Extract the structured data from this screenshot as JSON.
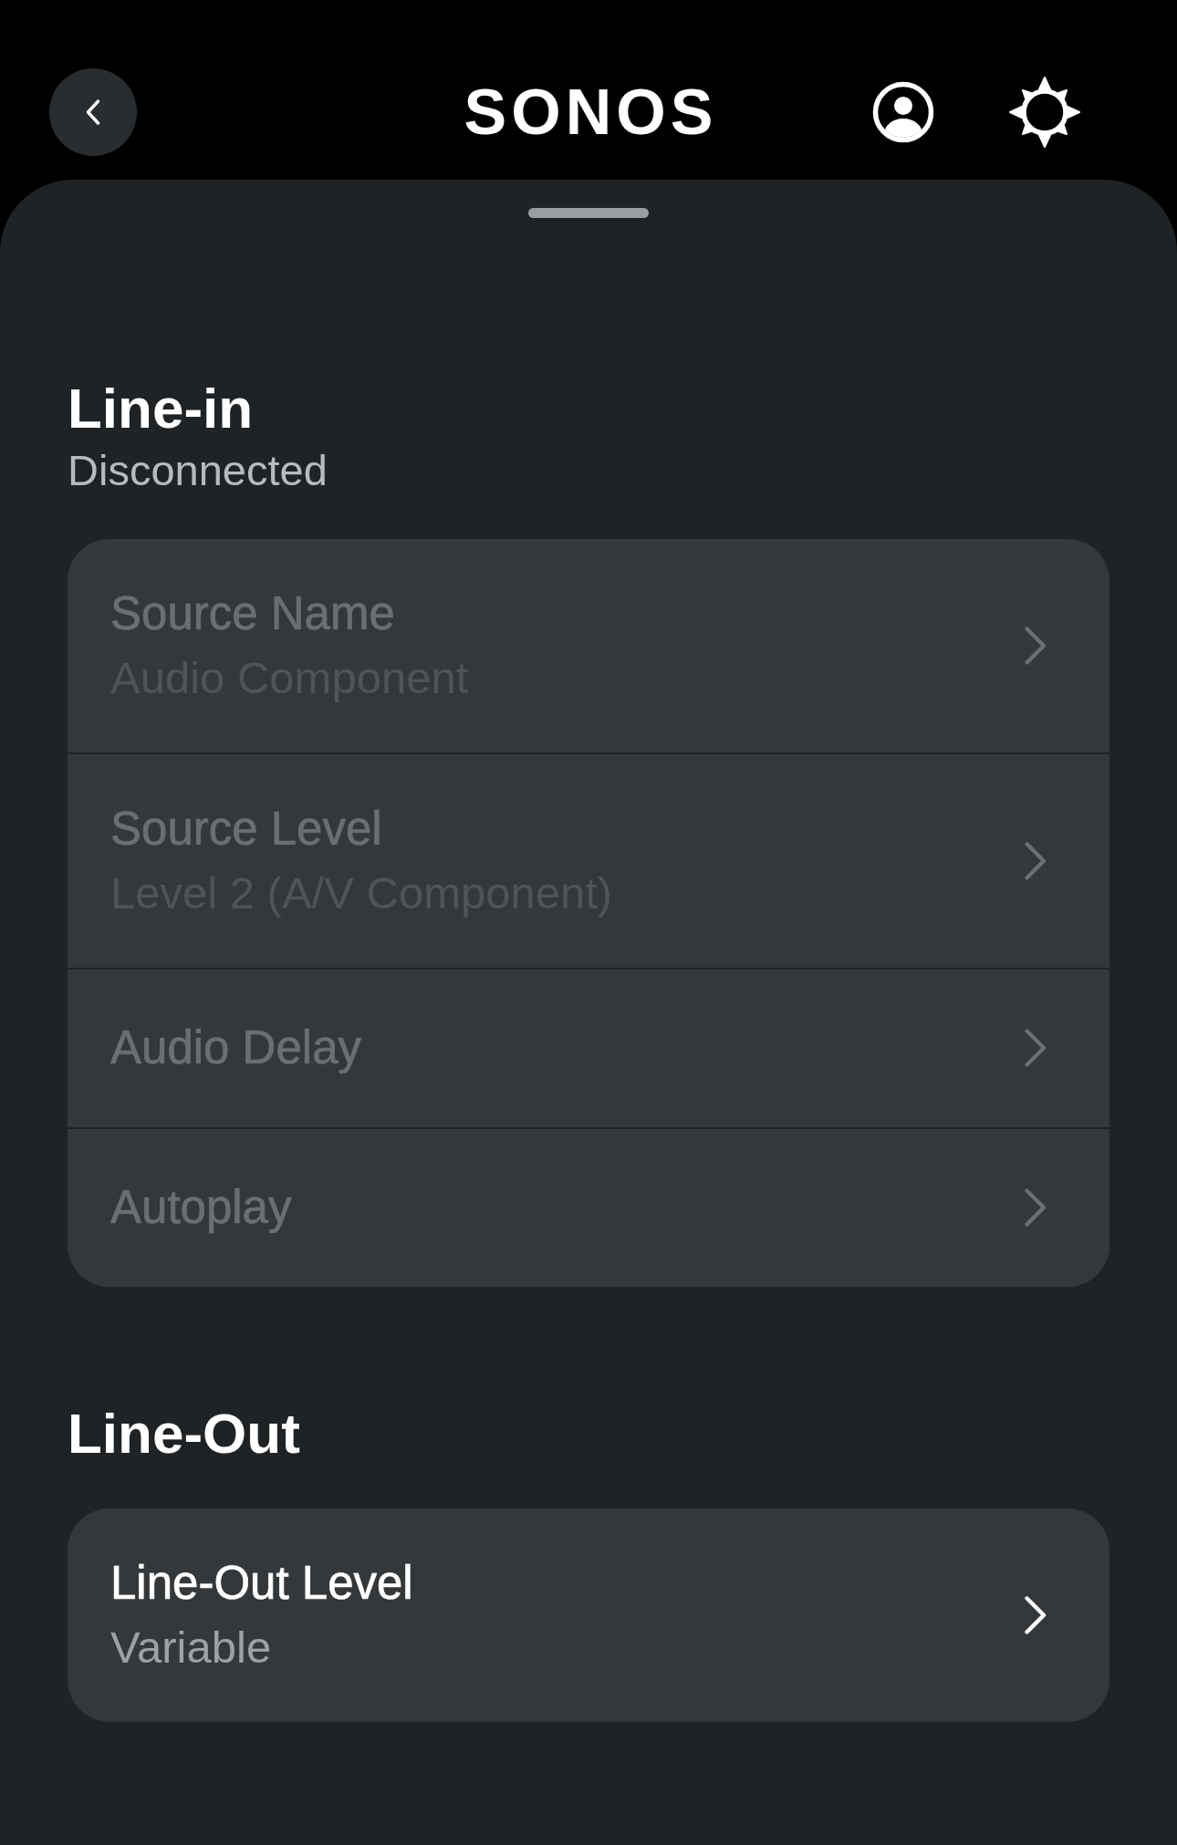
{
  "header": {
    "logo": "SONOS"
  },
  "sheet": {
    "sections": [
      {
        "title": "Line-in",
        "status": "Disconnected",
        "rows": [
          {
            "title": "Source Name",
            "value": "Audio Component",
            "disabled": true
          },
          {
            "title": "Source Level",
            "value": "Level 2 (A/V Component)",
            "disabled": true
          },
          {
            "title": "Audio Delay",
            "disabled": true
          },
          {
            "title": "Autoplay",
            "disabled": true
          }
        ]
      },
      {
        "title": "Line-Out",
        "rows": [
          {
            "title": "Line-Out Level",
            "value": "Variable",
            "disabled": false
          }
        ]
      }
    ]
  }
}
